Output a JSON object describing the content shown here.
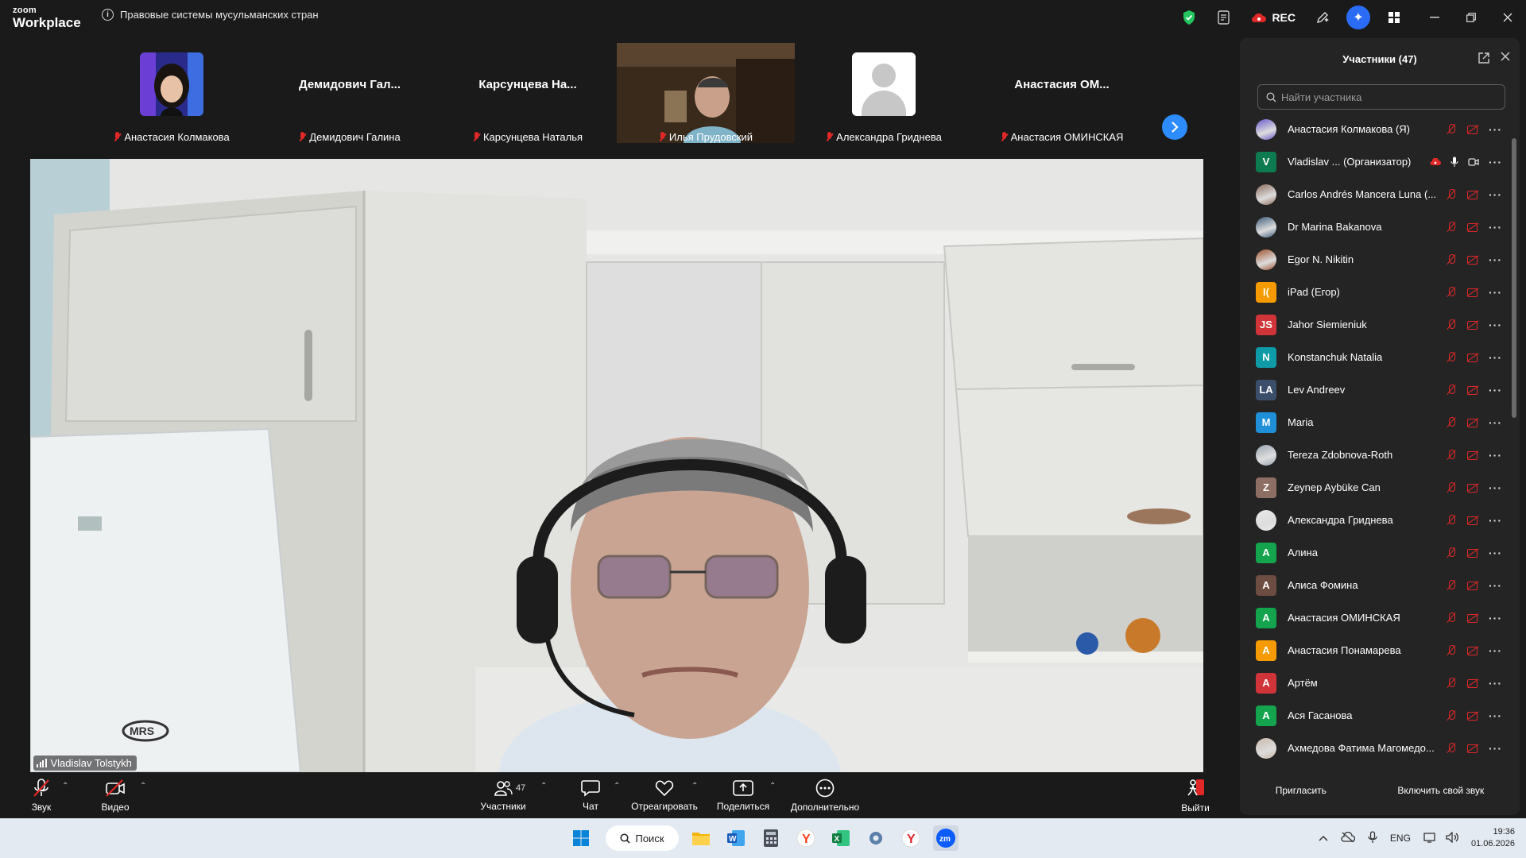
{
  "app": {
    "logo_line1": "zoom",
    "logo_line2": "Workplace",
    "meeting_title": "Правовые системы мусульманских стран",
    "rec_label": "REC"
  },
  "gallery": {
    "tiles": [
      {
        "label": "Анастасия Колмакова",
        "display": "photo"
      },
      {
        "label": "Демидович Галина",
        "display": "name",
        "big_name": "Демидович  Гал..."
      },
      {
        "label": "Карсунцева Наталья",
        "display": "name",
        "big_name": "Карсунцева  На..."
      },
      {
        "label": "Илья Прудовский",
        "display": "video"
      },
      {
        "label": "Александра Гриднева",
        "display": "avatar"
      },
      {
        "label": "Анастасия ОМИНСКАЯ",
        "display": "name",
        "big_name": "Анастасия  ОМ..."
      }
    ]
  },
  "main_video": {
    "speaker": "Vladislav Tolstykh"
  },
  "toolbar": {
    "audio": "Звук",
    "video": "Видео",
    "participants": "Участники",
    "participants_count": "47",
    "chat": "Чат",
    "react": "Отреагировать",
    "share": "Поделиться",
    "more": "Дополнительно",
    "leave": "Выйти"
  },
  "panel": {
    "title": "Участники (47)",
    "search_placeholder": "Найти участника",
    "invite": "Пригласить",
    "unmute_self": "Включить свой звук",
    "participants": [
      {
        "name": "Анастасия Колмакова (Я)",
        "initials": "",
        "color": "#6a5acd",
        "photo": true
      },
      {
        "name": "Vladislav ...  (Организатор)",
        "initials": "V",
        "color": "#0d7a4f",
        "host": true
      },
      {
        "name": "Carlos Andrés Mancera Luna (...",
        "initials": "",
        "color": "#8a6a5a",
        "photo": true
      },
      {
        "name": "Dr Marina Bakanova",
        "initials": "",
        "color": "#3b5a7a",
        "photo": true
      },
      {
        "name": "Egor N. Nikitin",
        "initials": "",
        "color": "#a0522d",
        "photo": true
      },
      {
        "name": "iPad (Егор)",
        "initials": "I(",
        "color": "#f59b00"
      },
      {
        "name": "Jahor Siemieniuk",
        "initials": "JS",
        "color": "#d13438"
      },
      {
        "name": "Konstanchuk Natalia",
        "initials": "N",
        "color": "#0e9aa7"
      },
      {
        "name": "Lev Andreev",
        "initials": "LA",
        "color": "#3b4f6b"
      },
      {
        "name": "Maria",
        "initials": "M",
        "color": "#1f8fd8"
      },
      {
        "name": "Tereza Zdobnova-Roth",
        "initials": "",
        "color": "#9aa5b1",
        "photo": true
      },
      {
        "name": "Zeynep Aybüke Can",
        "initials": "Z",
        "color": "#8d6e63"
      },
      {
        "name": "Александра Гриднева",
        "initials": "",
        "color": "#e8e8e8",
        "photo": true
      },
      {
        "name": "Алина",
        "initials": "А",
        "color": "#14a44d"
      },
      {
        "name": "Алиса Фомина",
        "initials": "А",
        "color": "#6d4c41"
      },
      {
        "name": "Анастасия ОМИНСКАЯ",
        "initials": "А",
        "color": "#14a44d"
      },
      {
        "name": "Анастасия Понамарева",
        "initials": "А",
        "color": "#f59b00"
      },
      {
        "name": "Артём",
        "initials": "А",
        "color": "#d13438"
      },
      {
        "name": "Ася Гасанова",
        "initials": "А",
        "color": "#14a44d"
      },
      {
        "name": "Ахмедова Фатима Магомедо...",
        "initials": "",
        "color": "#c9b8a8",
        "photo": true
      }
    ]
  },
  "taskbar": {
    "search_label": "Поиск",
    "lang": "ENG",
    "time": "19:36",
    "date": "01.06.2026"
  }
}
